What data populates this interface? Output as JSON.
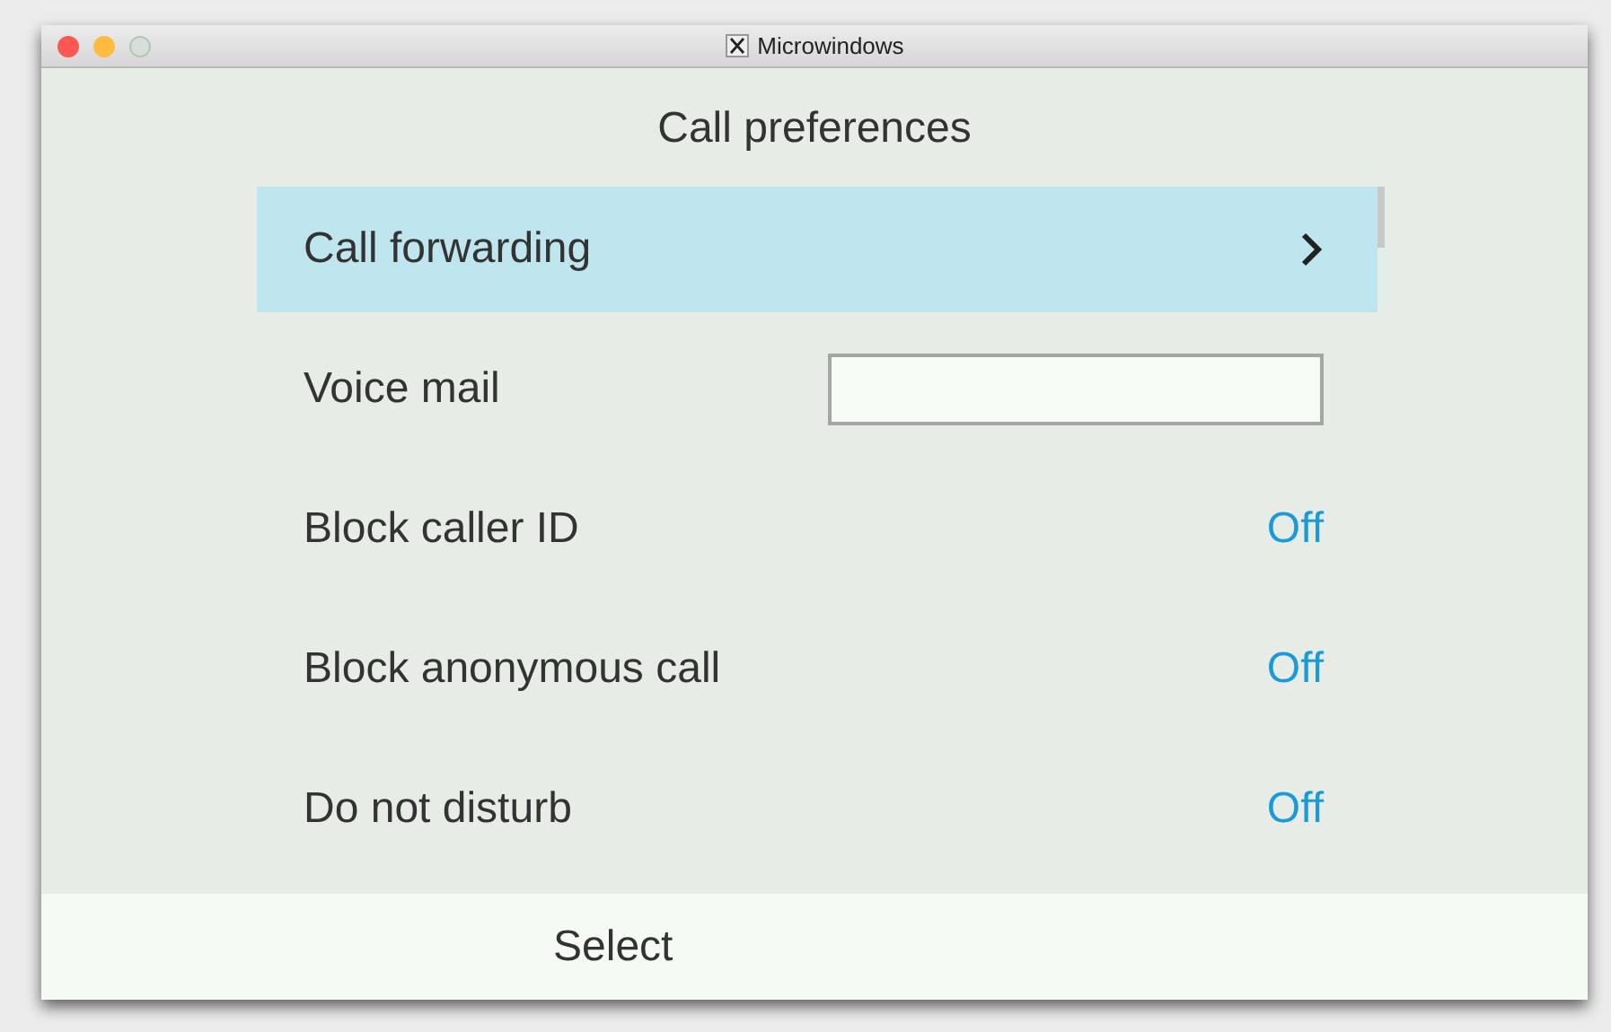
{
  "window": {
    "title": "Microwindows"
  },
  "screen_title": "Call preferences",
  "items": [
    {
      "kind": "link",
      "label": "Call forwarding",
      "selected": true
    },
    {
      "kind": "field",
      "label": "Voice mail",
      "selected": false
    },
    {
      "kind": "value",
      "label": "Block caller ID",
      "value": "Off",
      "selected": false
    },
    {
      "kind": "value",
      "label": "Block anonymous call",
      "value": "Off",
      "selected": false
    },
    {
      "kind": "value",
      "label": "Do not disturb",
      "value": "Off",
      "selected": false
    }
  ],
  "softkeys": [
    "Select"
  ]
}
